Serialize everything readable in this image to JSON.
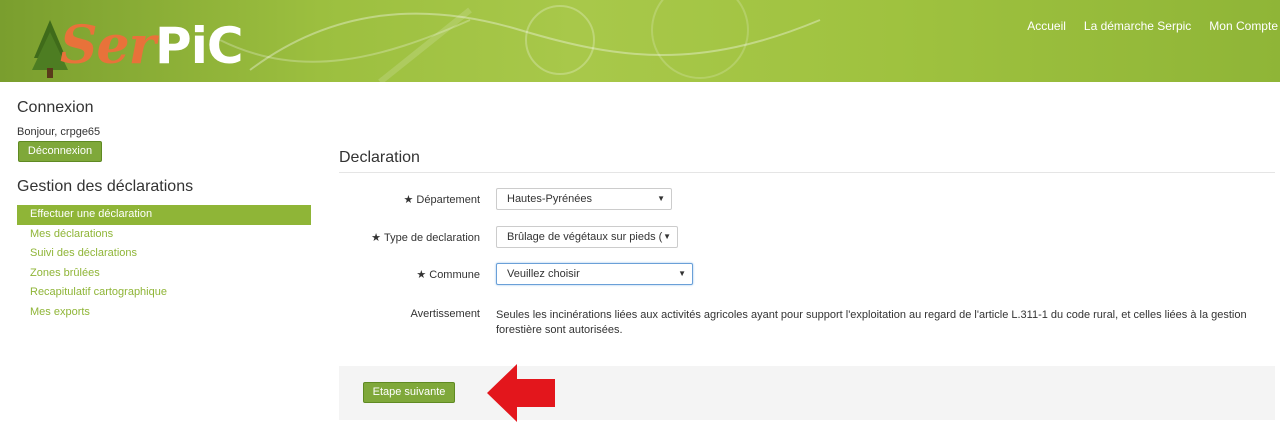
{
  "header": {
    "logo_text_ser": "Ser",
    "logo_text_pic": "PiC",
    "nav": [
      "Accueil",
      "La démarche Serpic",
      "Mon Compte"
    ]
  },
  "sidebar": {
    "connexion_title": "Connexion",
    "greeting": "Bonjour, crpge65",
    "logout_label": "Déconnexion",
    "gestion_title": "Gestion des déclarations",
    "menu": [
      "Effectuer une déclaration",
      "Mes déclarations",
      "Suivi des déclarations",
      "Zones brûlées",
      "Recapitulatif cartographique",
      "Mes exports"
    ]
  },
  "form": {
    "title": "Declaration",
    "departement_label": "Département",
    "departement_value": "Hautes-Pyrénées",
    "type_label": "Type de declaration",
    "type_value": "Brûlage de végétaux sur pieds (",
    "commune_label": "Commune",
    "commune_value": "Veuillez choisir",
    "warning_label": "Avertissement",
    "warning_text": "Seules les incinérations liées aux activités agricoles ayant pour support l'exploitation au regard de l'article L.311-1 du code rural, et celles liées à la gestion forestière sont autorisées.",
    "next_label": "Etape suivante"
  },
  "colors": {
    "brand_green": "#8fb537",
    "button_green": "#7fa83a",
    "arrow_red": "#e3161c",
    "logo_orange": "#e8723a"
  }
}
